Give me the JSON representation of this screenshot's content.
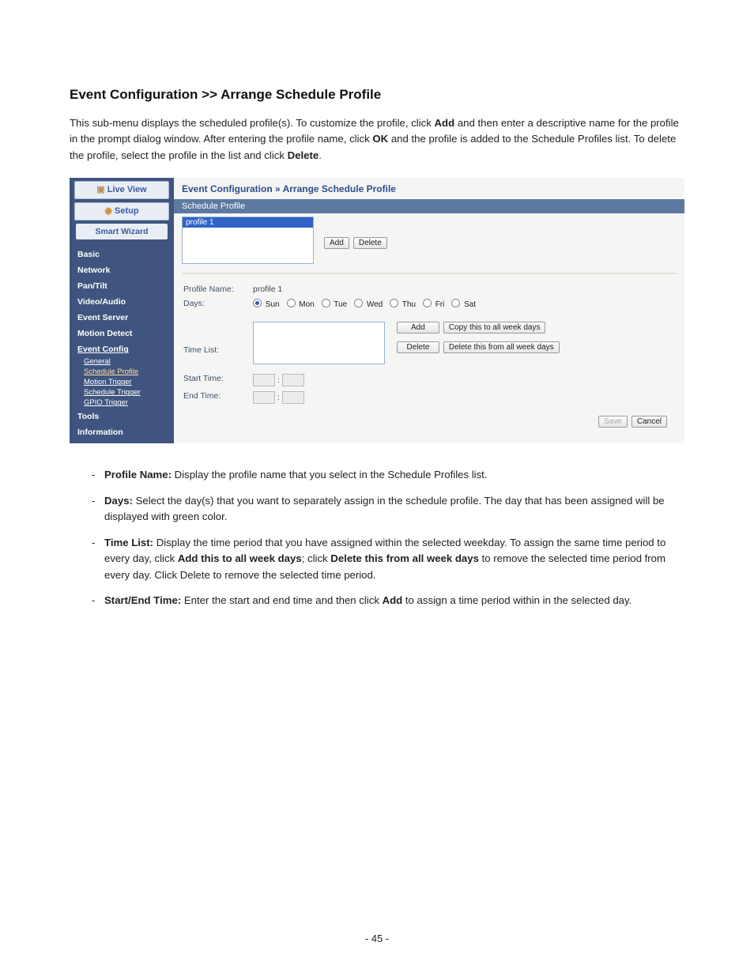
{
  "title": "Event Configuration >> Arrange Schedule Profile",
  "intro": {
    "part1": "This sub-menu displays the scheduled profile(s). To customize the profile, click ",
    "add": "Add",
    "part2": " and then enter a descriptive name for the profile in the prompt dialog window. After entering the profile name, click ",
    "ok": "OK",
    "part3": " and the profile is added to the Schedule Profiles list. To delete the profile, select the profile in the list and click ",
    "delete": "Delete",
    "part4": "."
  },
  "sidebar": {
    "live": "Live View",
    "setup": "Setup",
    "wizard": "Smart Wizard",
    "items": [
      "Basic",
      "Network",
      "Pan/Tilt",
      "Video/Audio",
      "Event Server",
      "Motion Detect",
      "Event Config"
    ],
    "subs": [
      "General",
      "Schedule Profile",
      "Motion Trigger",
      "Schedule Trigger",
      "GPIO Trigger"
    ],
    "tail": [
      "Tools",
      "Information"
    ]
  },
  "main": {
    "crumb_a": "Event Configuration ",
    "crumb_sep": "»",
    "crumb_b": " Arrange Schedule Profile",
    "band": "Schedule Profile",
    "list_item": "profile 1",
    "btn_add": "Add",
    "btn_delete": "Delete",
    "labels": {
      "profile_name": "Profile Name:",
      "days": "Days:",
      "time_list": "Time List:",
      "start_time": "Start Time:",
      "end_time": "End Time:"
    },
    "profile_name_value": "profile 1",
    "days": [
      "Sun",
      "Mon",
      "Tue",
      "Wed",
      "Thu",
      "Fri",
      "Sat"
    ],
    "tl_add": "Add",
    "tl_copy": "Copy this to all week days",
    "tl_del": "Delete",
    "tl_delall": "Delete this from all week days",
    "save": "Save",
    "cancel": "Cancel",
    "colon": ":"
  },
  "desc": {
    "profile_name": {
      "label": "Profile Name:",
      "text": " Display the profile name that you select in the Schedule Profiles list."
    },
    "days": {
      "label": "Days:",
      "text": " Select the day(s) that you want to separately assign in the schedule profile. The day that has been assigned will be displayed with green color."
    },
    "time_list": {
      "label": "Time List:",
      "p1": " Display the time period that you have assigned within the selected weekday. To assign the same time period to every day, click ",
      "b1": "Add this to all week days",
      "p2": "; click ",
      "b2": "Delete this from all week days",
      "p3": " to remove the selected time period from every day. Click Delete to remove the selected time period."
    },
    "start_end": {
      "label": "Start/End Time:",
      "p1": " Enter the start and end time and then click ",
      "b1": "Add",
      "p2": " to assign a time period within in the selected day."
    }
  },
  "page_number": "- 45 -"
}
